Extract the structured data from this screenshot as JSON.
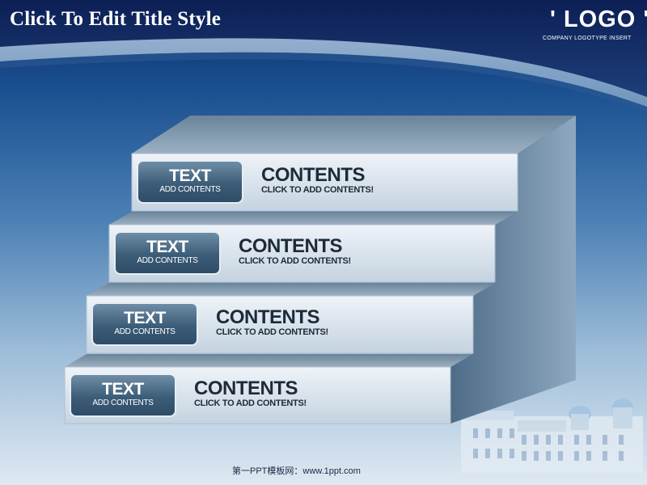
{
  "title": "Click To Edit Title Style",
  "logo": {
    "text": "' LOGO '",
    "subtitle": "COMPANY LOGOTYPE INSERT"
  },
  "steps": [
    {
      "box_title": "TEXT",
      "box_sub": "ADD CONTENTS",
      "contents_title": "CONTENTS",
      "contents_sub": "CLICK TO ADD CONTENTS!"
    },
    {
      "box_title": "TEXT",
      "box_sub": "ADD CONTENTS",
      "contents_title": "CONTENTS",
      "contents_sub": "CLICK TO ADD CONTENTS!"
    },
    {
      "box_title": "TEXT",
      "box_sub": "ADD CONTENTS",
      "contents_title": "CONTENTS",
      "contents_sub": "CLICK TO ADD CONTENTS!"
    },
    {
      "box_title": "TEXT",
      "box_sub": "ADD CONTENTS",
      "contents_title": "CONTENTS",
      "contents_sub": "CLICK TO ADD CONTENTS!"
    }
  ],
  "footer": "第一PPT模板网：www.1ppt.com",
  "colors": {
    "background_top": "#0d2a66",
    "background_bottom": "#dfe9f2",
    "step_face": "#d9e3ec",
    "step_top": "#7f97ab",
    "step_side": "#5a7690",
    "text_box": "#3c5d78",
    "contents_text": "#1e2a3a"
  }
}
